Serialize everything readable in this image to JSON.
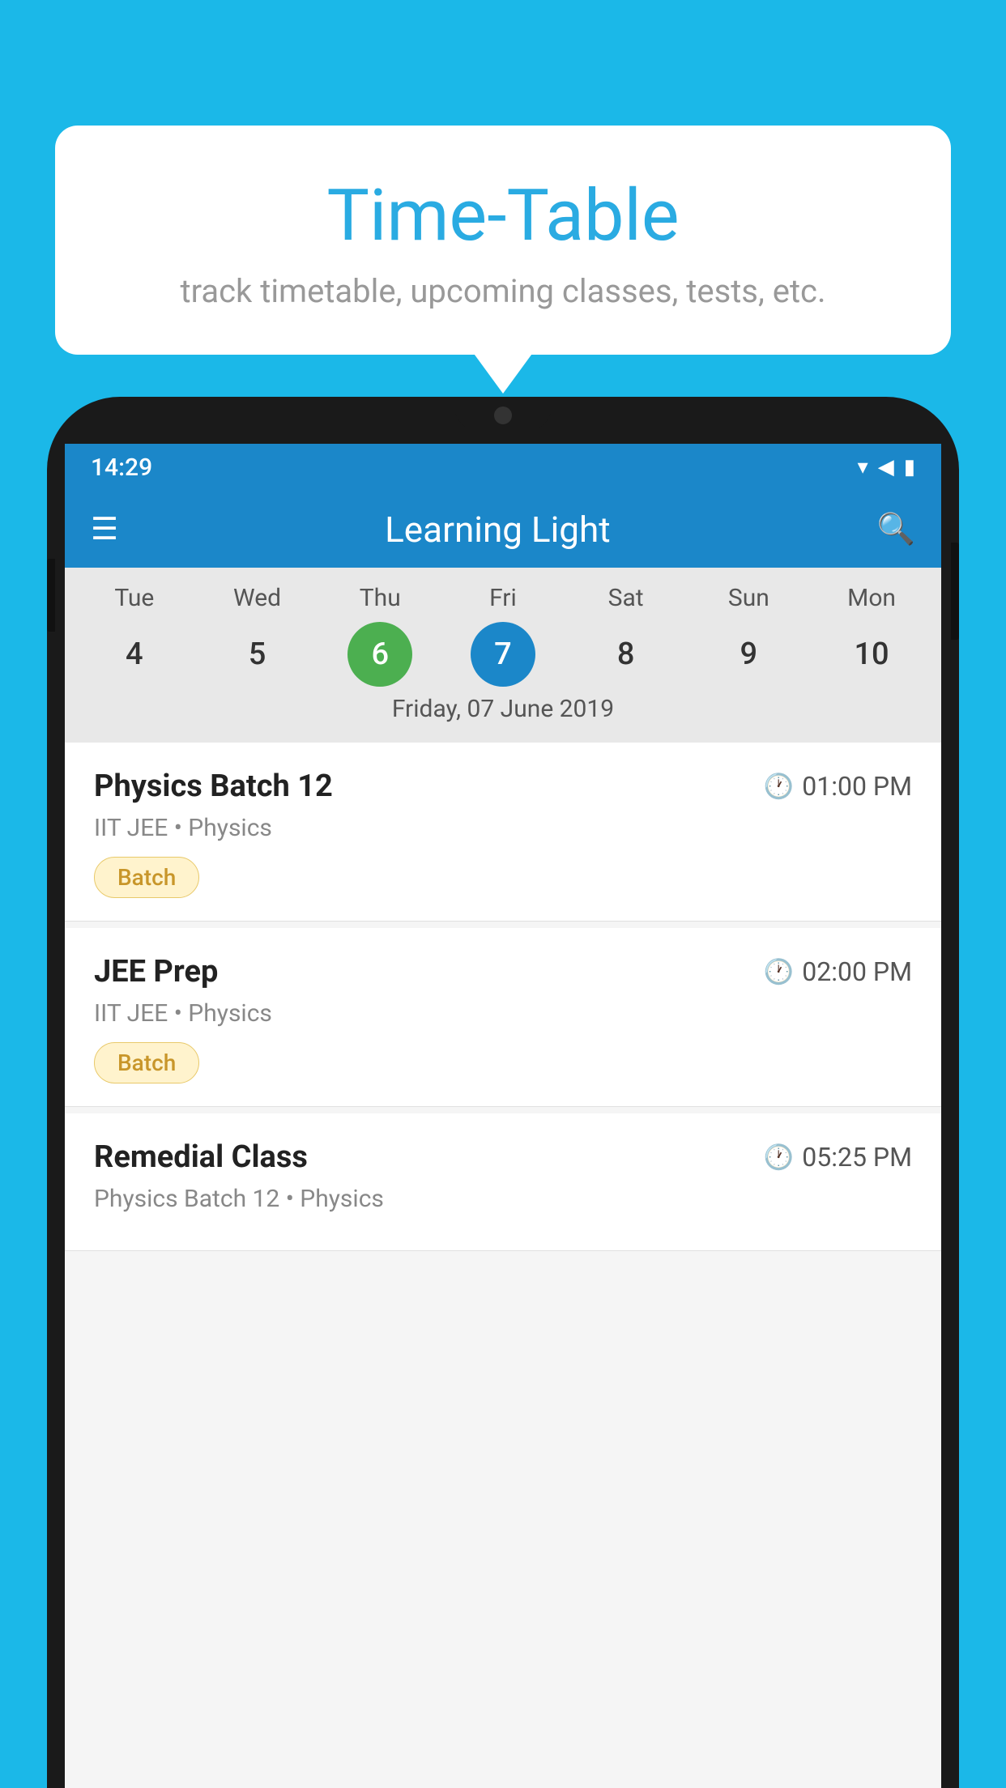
{
  "background_color": "#1BB8E8",
  "tooltip": {
    "title": "Time-Table",
    "subtitle": "track timetable, upcoming classes, tests, etc."
  },
  "phone": {
    "status_bar": {
      "time": "14:29"
    },
    "app_bar": {
      "title": "Learning Light"
    },
    "calendar": {
      "days": [
        {
          "label": "Tue",
          "num": "4"
        },
        {
          "label": "Wed",
          "num": "5"
        },
        {
          "label": "Thu",
          "num": "6",
          "state": "today"
        },
        {
          "label": "Fri",
          "num": "7",
          "state": "selected"
        },
        {
          "label": "Sat",
          "num": "8"
        },
        {
          "label": "Sun",
          "num": "9"
        },
        {
          "label": "Mon",
          "num": "10"
        }
      ],
      "selected_date_label": "Friday, 07 June 2019"
    },
    "classes": [
      {
        "name": "Physics Batch 12",
        "time": "01:00 PM",
        "subject": "IIT JEE • Physics",
        "badge": "Batch"
      },
      {
        "name": "JEE Prep",
        "time": "02:00 PM",
        "subject": "IIT JEE • Physics",
        "badge": "Batch"
      },
      {
        "name": "Remedial Class",
        "time": "05:25 PM",
        "subject": "Physics Batch 12 • Physics",
        "badge": null
      }
    ]
  }
}
